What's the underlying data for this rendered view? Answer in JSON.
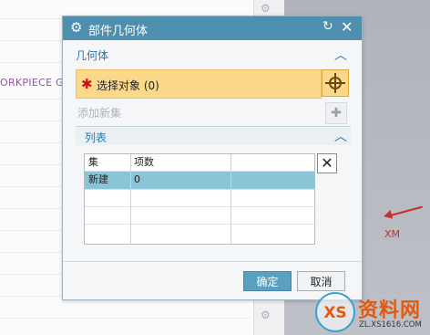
{
  "background": {
    "workpiece_text": "ORKPIECE G",
    "xm_label": "XM",
    "watermark": {
      "title": "资料网",
      "url": "ZL.XS1616.COM",
      "logo": "XS"
    }
  },
  "dialog": {
    "title": "部件几何体",
    "icons": {
      "gear": "gear-icon",
      "reset": "reset-icon",
      "close": "close-icon"
    },
    "geometry_section": {
      "header": "几何体",
      "select_object_label": "选择对象 (0)",
      "add_new_set_label": "添加新集"
    },
    "list_section": {
      "header": "列表",
      "columns": [
        "集",
        "项数"
      ],
      "rows": [
        {
          "set": "新建",
          "count": "0"
        }
      ]
    },
    "buttons": {
      "ok": "确定",
      "cancel": "取消"
    }
  },
  "colors": {
    "titlebar": "#4e8fb0",
    "select_highlight": "#fcd98a",
    "row_selected": "#89c5d6",
    "ok_button": "#5aa0c0"
  }
}
